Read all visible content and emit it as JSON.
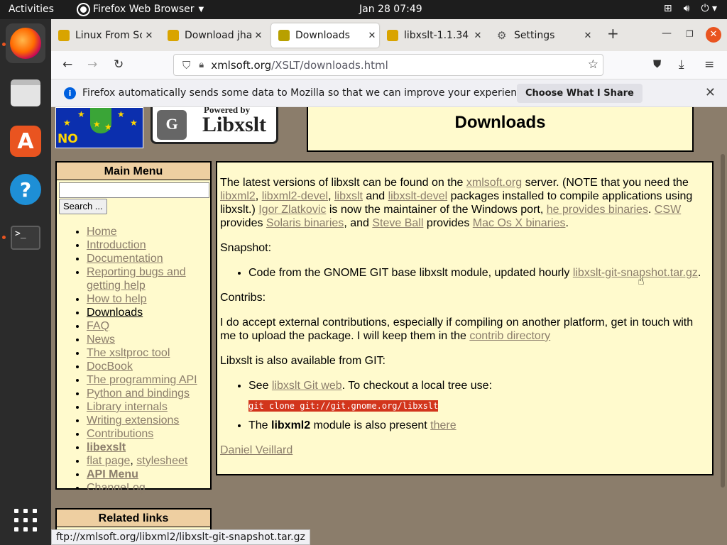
{
  "topbar": {
    "activities": "Activities",
    "app_name": "Firefox Web Browser",
    "clock": "Jan 28  07:49"
  },
  "tabs": [
    {
      "title": "Linux From Scratch",
      "fav_color": "#d9a400"
    },
    {
      "title": "Download jhalfs",
      "fav_color": "#d9a400"
    },
    {
      "title": "Downloads",
      "fav_color": "#b8a000"
    },
    {
      "title": "libxslt-1.1.34",
      "fav_color": "#d9a400"
    },
    {
      "title": "Settings",
      "fav_color": "#555555"
    }
  ],
  "navbar": {
    "url_host": "xmlsoft.org",
    "url_path": "/XSLT/downloads.html"
  },
  "notification": {
    "message": "Firefox automatically sends some data to Mozilla so that we can improve your experience.",
    "button": "Choose What I Share"
  },
  "logos": {
    "nopatents": "NO ePATENTS",
    "powered_by": "Powered by",
    "libxslt": "Libxslt",
    "gnome": "GNOME"
  },
  "page": {
    "title": "Downloads",
    "menu": {
      "header": "Main Menu",
      "search_button": "Search ...",
      "items": [
        {
          "label": "Home"
        },
        {
          "label": "Introduction"
        },
        {
          "label": "Documentation"
        },
        {
          "label": "Reporting bugs and getting help"
        },
        {
          "label": "How to help"
        },
        {
          "label": "Downloads"
        },
        {
          "label": "FAQ"
        },
        {
          "label": "News"
        },
        {
          "label": "The xsltproc tool"
        },
        {
          "label": "DocBook"
        },
        {
          "label": "The programming API"
        },
        {
          "label": "Python and bindings"
        },
        {
          "label": "Library internals"
        },
        {
          "label": "Writing extensions"
        },
        {
          "label": "Contributions"
        },
        {
          "label": "libexslt"
        },
        {
          "label": "flat page"
        },
        {
          "label": "stylesheet"
        },
        {
          "label": "API Menu"
        },
        {
          "label": "ChangeLog"
        }
      ]
    },
    "related_header": "Related links",
    "content": {
      "p1_a": "The latest versions of libxslt can be found on the ",
      "p1_link_server": "xmlsoft.org",
      "p1_b": " server. (NOTE that you need the ",
      "p1_link_libxml2": "libxml2",
      "p1_c": ", ",
      "p1_link_libxml2_devel": "libxml2-devel",
      "p1_d": ", ",
      "p1_link_libxslt": "libxslt",
      "p1_e": " and ",
      "p1_link_libxslt_devel": "libxslt-devel",
      "p1_f": " packages installed to compile applications using libxslt.) ",
      "p1_link_igor": "Igor Zlatkovic",
      "p1_g": " is now the maintainer of the Windows port, ",
      "p1_link_binaries": "he provides binaries",
      "p1_h": ". ",
      "p1_link_csw": "CSW",
      "p1_i": " provides ",
      "p1_link_solaris": "Solaris binaries",
      "p1_j": ", and ",
      "p1_link_steve": "Steve Ball",
      "p1_k": " provides ",
      "p1_link_macos": "Mac Os X binaries",
      "p1_l": ".",
      "snapshot_label": "Snapshot:",
      "snapshot_text": "Code from the GNOME GIT base libxslt module, updated hourly ",
      "snapshot_link": "libxslt-git-snapshot.tar.gz",
      "snapshot_end": ".",
      "contribs_label": "Contribs:",
      "contribs_text": "I do accept external contributions, especially if compiling on another platform, get in touch with me to upload the package. I will keep them in the ",
      "contribs_link": "contrib directory",
      "git_label": "Libxslt is also available from GIT:",
      "git_see": "See ",
      "git_link": "libxslt Git web",
      "git_after": ". To checkout a local tree use:",
      "git_cmd": "git clone git://git.gnome.org/libxslt",
      "libxml2_a": "The ",
      "libxml2_bold": "libxml2",
      "libxml2_b": " module is also present ",
      "libxml2_link": "there",
      "author": "Daniel Veillard"
    }
  },
  "statusbar": "ftp://xmlsoft.org/libxml2/libxslt-git-snapshot.tar.gz",
  "colors": {
    "page_bg": "#8b7d6b",
    "box_bg": "#fffacd",
    "header_bg": "#eecfa1",
    "link": "#8b7d6b",
    "code_bg": "#d2351c",
    "ubuntu_accent": "#e95420"
  }
}
